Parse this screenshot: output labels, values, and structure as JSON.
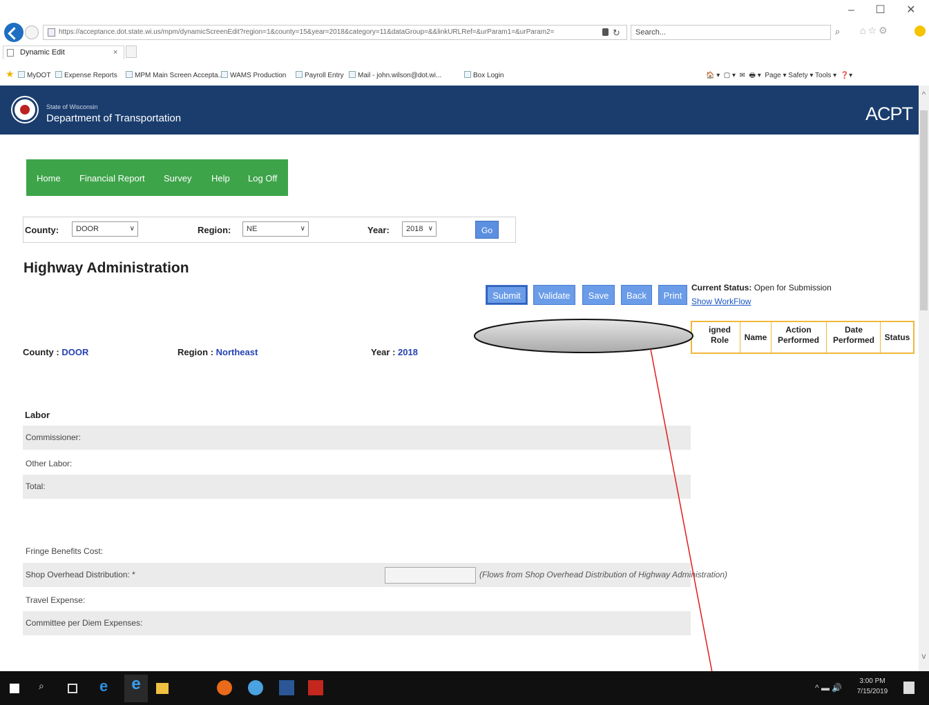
{
  "browser": {
    "url": "https://acceptance.dot.state.wi.us/mpm/dynamicScreenEdit?region=1&county=15&year=2018&category=11&dataGroup=&&linkURLRef=&urParam1=&urParam2=",
    "search_placeholder": "Search...",
    "tab_title": "Dynamic Edit",
    "window_controls": "–  ☐  ✕",
    "favorites": [
      {
        "label": "MyDOT"
      },
      {
        "label": "Expense Reports"
      },
      {
        "label": "MPM Main Screen Accepta..."
      },
      {
        "label": "WAMS Production"
      },
      {
        "label": "Payroll Entry"
      },
      {
        "label": "Mail - john.wilson@dot.wi..."
      },
      {
        "label": "Box Login"
      }
    ],
    "command_bar": "Page ▾  Safety ▾  Tools ▾"
  },
  "header": {
    "state": "State of Wisconsin",
    "department": "Department of Transportation",
    "app_title": "ACPT",
    "bg_color": "#1a3d6e"
  },
  "nav": {
    "items": [
      "Home",
      "Financial Report",
      "Survey",
      "Help",
      "Log Off"
    ],
    "bg_color": "#3ea44a"
  },
  "filters": {
    "county_label": "County:",
    "county_value": "DOOR",
    "region_label": "Region:",
    "region_value": "NE",
    "year_label": "Year:",
    "year_value": "2018",
    "go_label": "Go"
  },
  "page_title": "Highway Administration",
  "actions": {
    "submit": "Submit",
    "validate": "Validate",
    "save": "Save",
    "back": "Back",
    "print": "Print"
  },
  "status": {
    "label": "Current Status:",
    "value": "Open for Submission",
    "workflow_link": "Show WorkFlow"
  },
  "workflow_table": {
    "headers": [
      "Assigned Role",
      "Name",
      "Action Performed",
      "Date Performed",
      "Status"
    ],
    "headers_visible": [
      "igned\nRole",
      "Name",
      "Action\nPerformed",
      "Date\nPerformed",
      "Status"
    ],
    "border_color": "#f0b73a"
  },
  "info": {
    "county_label": "County :",
    "county_value": "DOOR",
    "region_label": "Region :",
    "region_value": "Northeast",
    "year_label": "Year :",
    "year_value": "2018"
  },
  "form": {
    "labor_heading": "Labor",
    "commissioner": "Commissioner:",
    "other_labor": "Other Labor:",
    "total": "Total:",
    "fringe": "Fringe Benefits Cost:",
    "shop_overhead": "Shop Overhead Distribution: *",
    "shop_overhead_note": "(Flows from Shop Overhead Distribution of Highway Administration)",
    "travel": "Travel Expense:",
    "committee": "Committee per Diem Expenses:"
  },
  "taskbar": {
    "time": "3:00 PM",
    "date": "7/15/2019"
  }
}
